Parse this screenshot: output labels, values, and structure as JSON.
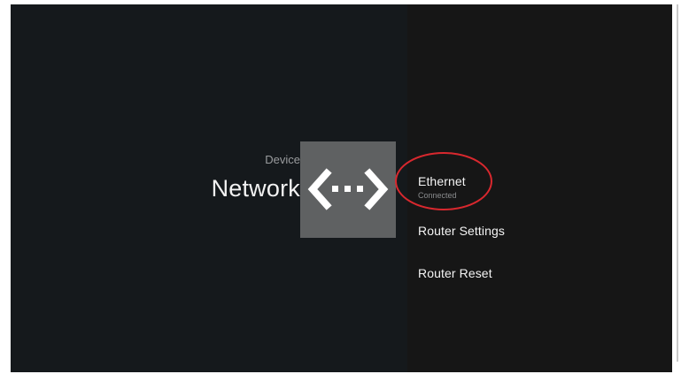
{
  "header": {
    "breadcrumb": "Device",
    "title": "Network"
  },
  "icon": {
    "name": "network-icon"
  },
  "menu": {
    "items": [
      {
        "label": "Ethernet",
        "sublabel": "Connected"
      },
      {
        "label": "Router Settings"
      },
      {
        "label": "Router Reset"
      }
    ]
  },
  "colors": {
    "left_pane": "#15191c",
    "right_pane": "#161616",
    "icon_tile": "#5f6162",
    "highlight": "#d8282e"
  }
}
